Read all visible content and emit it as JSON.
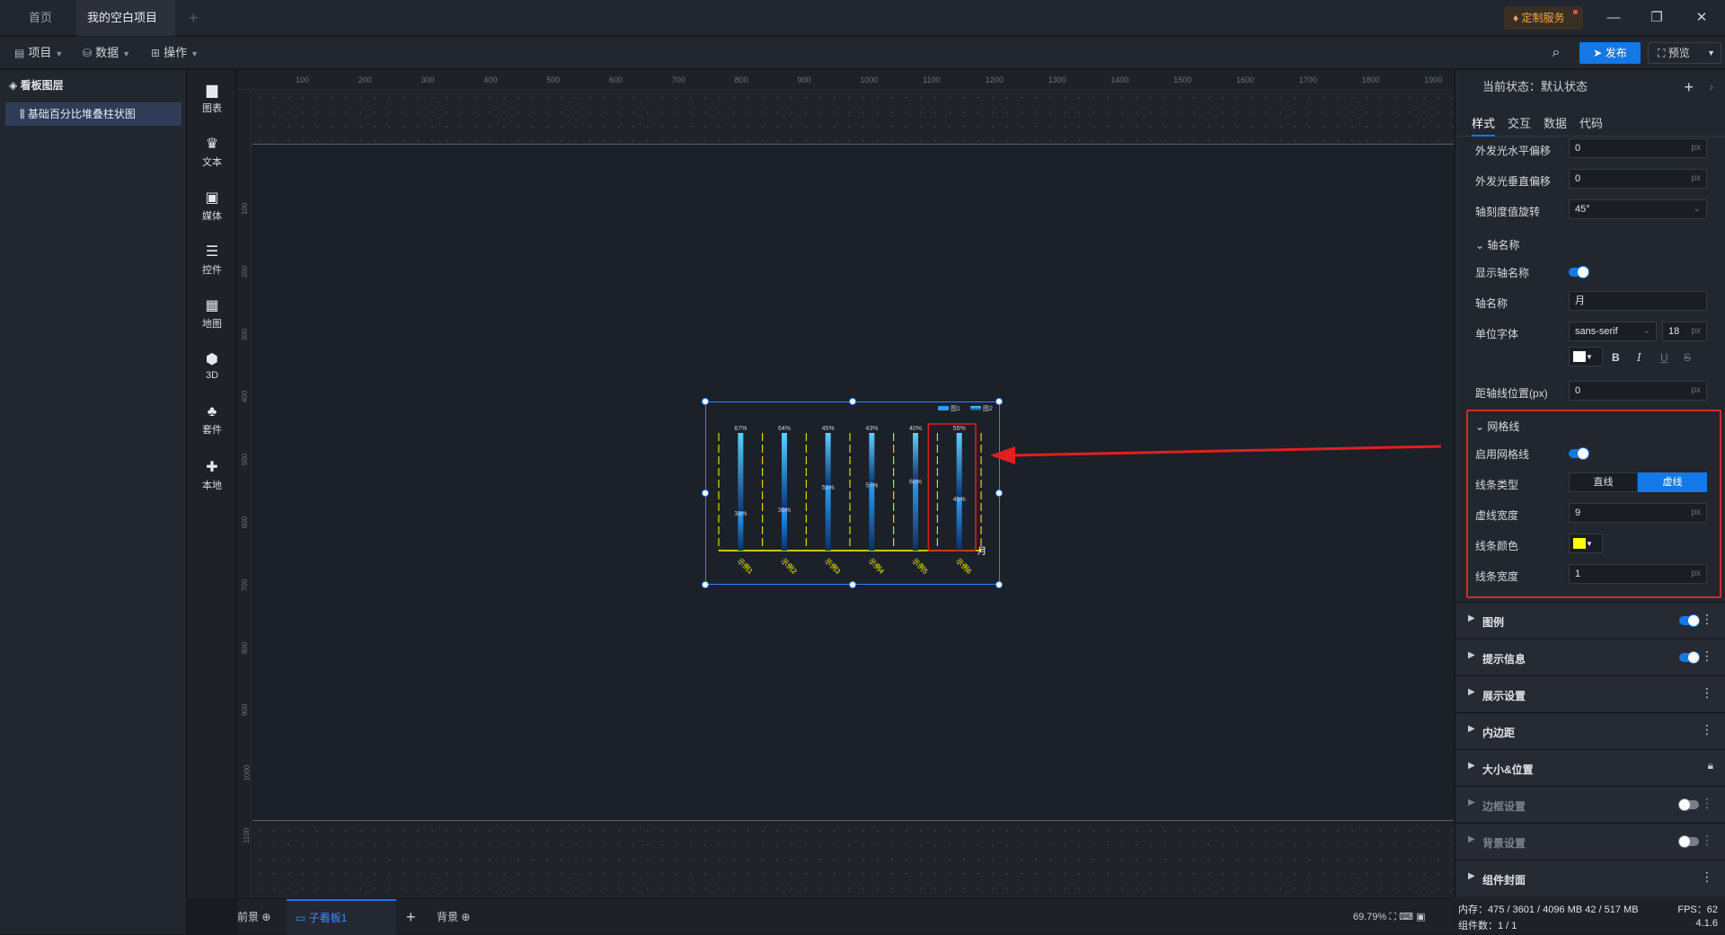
{
  "titlebar": {
    "tabs": [
      {
        "label": "首页"
      },
      {
        "label": "我的空白项目"
      }
    ],
    "custom_service": "定制服务"
  },
  "menubar": {
    "project": "项目",
    "data": "数据",
    "operate": "操作",
    "publish": "发布",
    "preview": "预览"
  },
  "layers": {
    "header": "看板图层",
    "item": "基础百分比堆叠柱状图"
  },
  "tools": [
    "图表",
    "文本",
    "媒体",
    "控件",
    "地图",
    "3D",
    "套件",
    "本地"
  ],
  "ruler": {
    "top": [
      "100",
      "200",
      "300",
      "400",
      "500",
      "600",
      "700",
      "800",
      "900",
      "1000",
      "1100",
      "1200",
      "1300",
      "1400",
      "1500",
      "1600",
      "1700",
      "1800",
      "1900"
    ],
    "left": [
      "100",
      "200",
      "300",
      "400",
      "500",
      "600",
      "700",
      "800",
      "900",
      "1000",
      "1100"
    ]
  },
  "chart_data": {
    "type": "bar",
    "categories": [
      "示例1",
      "示例2",
      "示例3",
      "示例4",
      "示例5",
      "示例6"
    ],
    "series": [
      {
        "name": "图1",
        "values": [
          33,
          36,
          55,
          57,
          60,
          45
        ]
      },
      {
        "name": "图2",
        "values": [
          67,
          64,
          45,
          43,
          40,
          55
        ]
      }
    ],
    "labels_bottom": [
      "33%",
      "36%",
      "55%",
      "57%",
      "60%",
      "45%"
    ],
    "labels_top": [
      "67%",
      "64%",
      "45%",
      "43%",
      "40%",
      "55%"
    ],
    "xlabel": "月",
    "colors": {
      "axis": "#ffff00",
      "bar": "#2a9df4",
      "grid": "#ffff00"
    },
    "legend_position": "top-right",
    "stacked_percent": true
  },
  "bottombar": {
    "front": "前景",
    "sub": "子看板1",
    "back": "背景",
    "zoom": "69.79%"
  },
  "rpanel": {
    "state": "当前状态：默认状态",
    "tabs": [
      "样式",
      "交互",
      "数据",
      "代码"
    ],
    "glow_h": {
      "label": "外发光水平偏移",
      "value": "0",
      "unit": "px"
    },
    "glow_v": {
      "label": "外发光垂直偏移",
      "value": "0",
      "unit": "px"
    },
    "tick_rot": {
      "label": "轴刻度值旋转",
      "value": "45°"
    },
    "axis_name_section": "轴名称",
    "show_axis_name": "显示轴名称",
    "axis_name": {
      "label": "轴名称",
      "value": "月"
    },
    "unit_font": {
      "label": "单位字体",
      "family": "sans-serif",
      "size": "18",
      "unit": "px"
    },
    "axis_offset": {
      "label": "距轴线位置(px)",
      "value": "0",
      "unit": "px"
    },
    "grid_section": "网格线",
    "enable_grid": "启用网格线",
    "line_type": {
      "label": "线条类型",
      "options": [
        "直线",
        "虚线"
      ],
      "selected": "虚线"
    },
    "dash_width": {
      "label": "虚线宽度",
      "value": "9",
      "unit": "px"
    },
    "line_color": {
      "label": "线条颜色",
      "color": "#ffff00"
    },
    "line_width": {
      "label": "线条宽度",
      "value": "1",
      "unit": "px"
    },
    "sections": [
      "图例",
      "提示信息",
      "展示设置",
      "内边距",
      "大小&位置",
      "边框设置",
      "背景设置",
      "组件封面"
    ]
  },
  "status": {
    "memory": "内存：475 / 3601 / 4096 MB  42 / 517 MB",
    "fps": "FPS：62",
    "count": "组件数：1 / 1",
    "version": "4.1.6"
  }
}
